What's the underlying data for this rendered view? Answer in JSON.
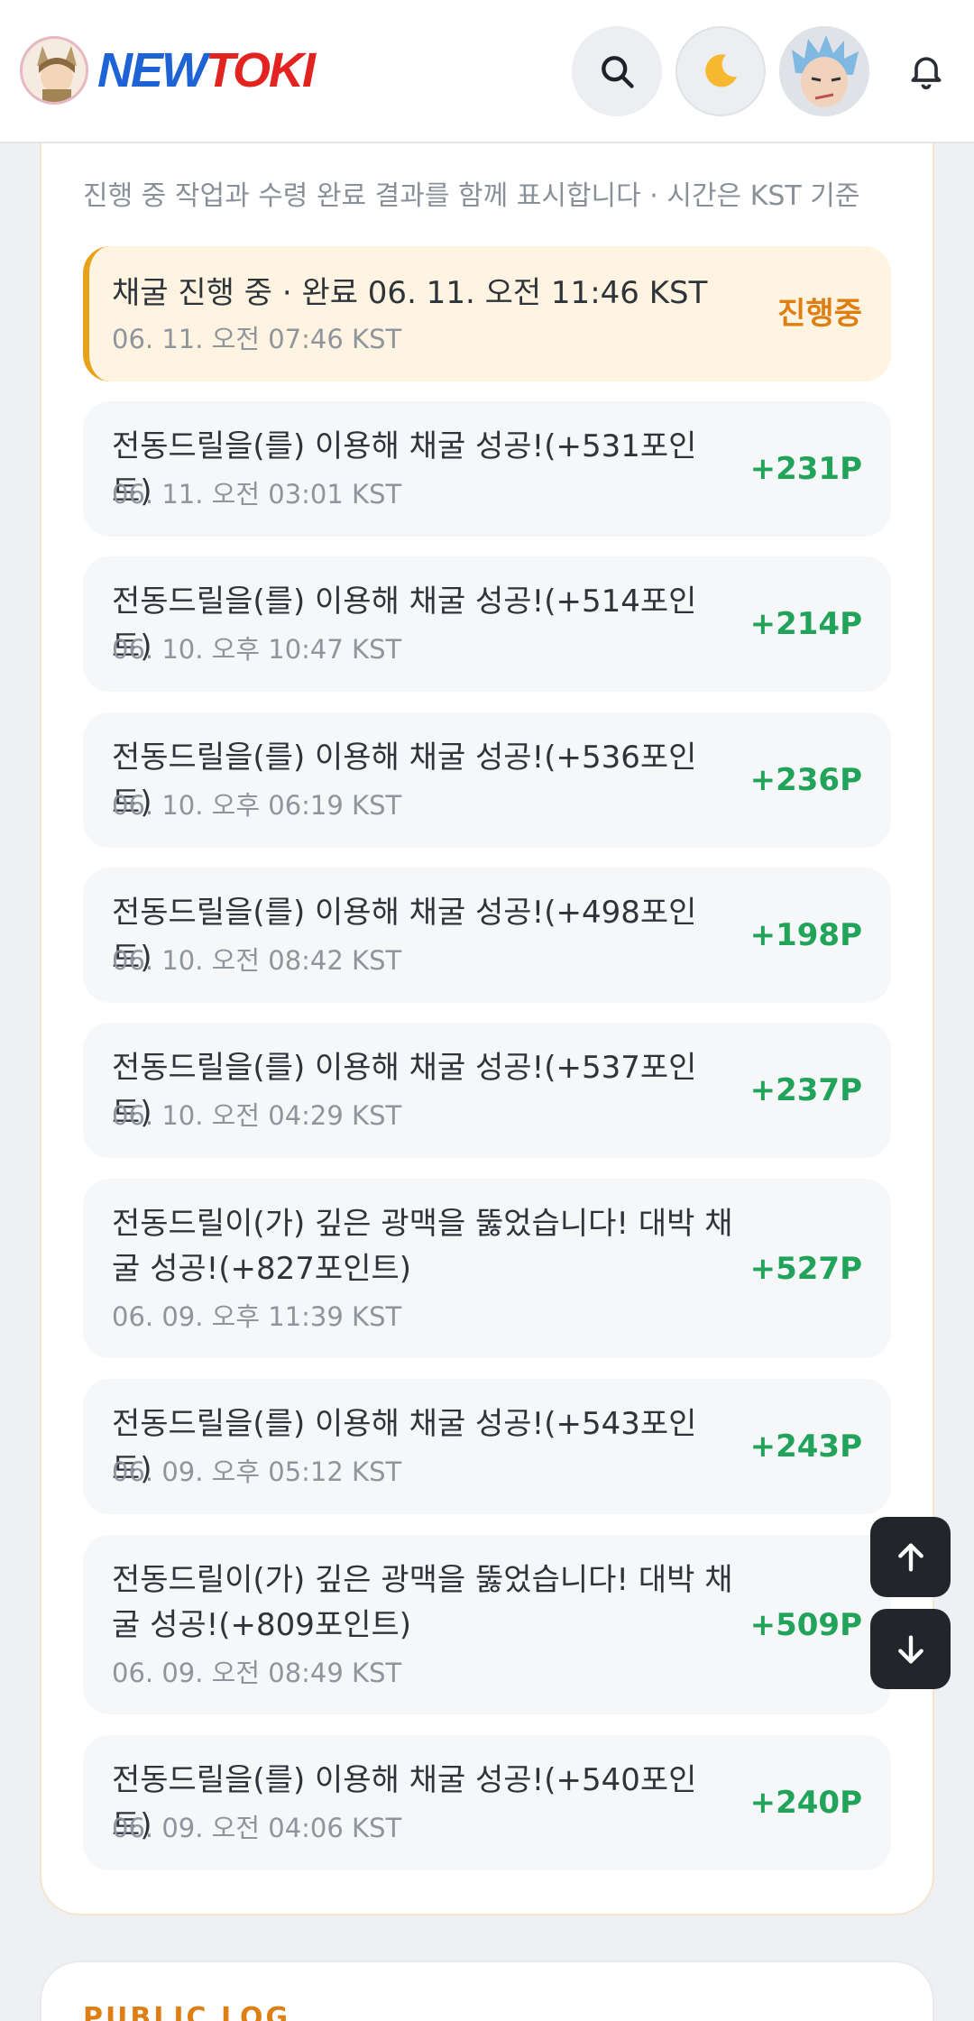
{
  "header": {
    "logo_part1": "NEW",
    "logo_part2": "TOKI",
    "icons": [
      "logo-avatar",
      "search-icon",
      "moon-icon",
      "profile-avatar",
      "bell-icon"
    ]
  },
  "history": {
    "subtitle": "진행 중 작업과 수령 완료 결과를 함께 표시합니다 · 시간은 KST 기준",
    "items": [
      {
        "title": "채굴 진행 중 · 완료 06. 11. 오전 11:46 KST",
        "time": "06. 11. 오전 07:46 KST",
        "points": "진행중",
        "status": "active"
      },
      {
        "title": "전동드릴을(를) 이용해 채굴 성공!(+531포인트)",
        "time": "06. 11. 오전 03:01 KST",
        "points": "+231P"
      },
      {
        "title": "전동드릴을(를) 이용해 채굴 성공!(+514포인트)",
        "time": "06. 10. 오후 10:47 KST",
        "points": "+214P"
      },
      {
        "title": "전동드릴을(를) 이용해 채굴 성공!(+536포인트)",
        "time": "06. 10. 오후 06:19 KST",
        "points": "+236P"
      },
      {
        "title": "전동드릴을(를) 이용해 채굴 성공!(+498포인트)",
        "time": "06. 10. 오전 08:42 KST",
        "points": "+198P"
      },
      {
        "title": "전동드릴을(를) 이용해 채굴 성공!(+537포인트)",
        "time": "06. 10. 오전 04:29 KST",
        "points": "+237P"
      },
      {
        "title": "전동드릴이(가) 깊은 광맥을 뚫었습니다! 대박 채굴 성공!(+827포인트)",
        "time": "06. 09. 오후 11:39 KST",
        "points": "+527P"
      },
      {
        "title": "전동드릴을(를) 이용해 채굴 성공!(+543포인트)",
        "time": "06. 09. 오후 05:12 KST",
        "points": "+243P"
      },
      {
        "title": "전동드릴이(가) 깊은 광맥을 뚫었습니다! 대박 채굴 성공!(+809포인트)",
        "time": "06. 09. 오전 08:49 KST",
        "points": "+509P"
      },
      {
        "title": "전동드릴을(를) 이용해 채굴 성공!(+540포인트)",
        "time": "06. 09. 오전 04:06 KST",
        "points": "+240P"
      }
    ]
  },
  "floating": {
    "up_icon": "arrow-up-icon",
    "down_icon": "arrow-down-icon"
  },
  "public_log": {
    "title": "PUBLIC LOG"
  },
  "colors": {
    "accent": "#de7f14",
    "positive": "#21a35a",
    "active_bg": "#fff4e2"
  }
}
